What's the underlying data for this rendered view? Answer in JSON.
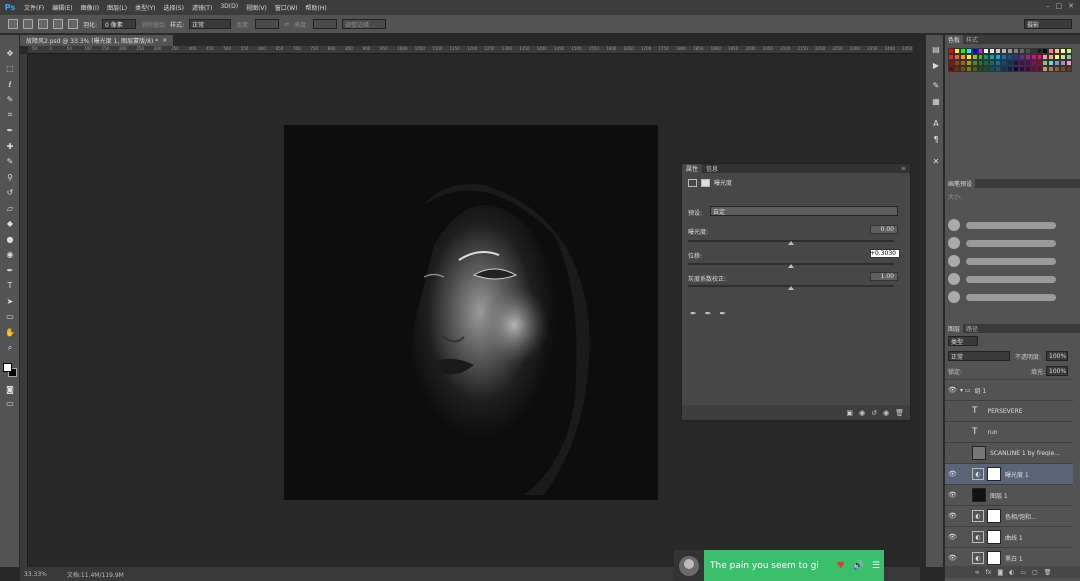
{
  "app": {
    "logo": "Ps"
  },
  "menubar": {
    "items": [
      "文件(F)",
      "编辑(E)",
      "图像(I)",
      "图层(L)",
      "类型(Y)",
      "选择(S)",
      "滤镜(T)",
      "3D(D)",
      "视图(V)",
      "窗口(W)",
      "帮助(H)"
    ],
    "window_controls": [
      "–",
      "□",
      "✕"
    ]
  },
  "options_bar": {
    "feather_label": "羽化:",
    "feather_value": "0 像素",
    "antialias_label": "消除锯齿",
    "style_label": "样式:",
    "style_value": "正常",
    "width_label": "宽度:",
    "height_label": "高度:",
    "refine_label": "调整边缘...",
    "workspace_value": "摄影"
  },
  "document": {
    "tab_title": "故障风2.psd @ 33.3% (曝光度 1, 图层蒙版/8) *",
    "tab_close": "×",
    "ruler_top_ticks": [
      "50",
      "0",
      "50",
      "100",
      "150",
      "200",
      "250",
      "300",
      "350",
      "400",
      "450",
      "500",
      "550",
      "600",
      "650",
      "700",
      "750",
      "800",
      "850",
      "900",
      "950",
      "1000",
      "1050",
      "1100",
      "1150",
      "1200",
      "1250",
      "1300",
      "1350",
      "1400",
      "1450",
      "1500",
      "1550",
      "1600",
      "1650",
      "1700",
      "1750",
      "1800",
      "1850",
      "1900",
      "1950",
      "2000",
      "2050",
      "2100",
      "2150",
      "2200",
      "2250",
      "2300",
      "2350",
      "2400",
      "2450"
    ]
  },
  "properties": {
    "tab_properties": "属性",
    "tab_info": "信息",
    "adjust_name": "曝光度",
    "preset_label": "预设:",
    "preset_value": "自定",
    "exposure_label": "曝光度:",
    "exposure_value": "0.00",
    "exposure_level": 0.5,
    "offset_label": "位移:",
    "offset_value": "+0.3030",
    "offset_level": 0.5,
    "gamma_label": "灰度系数校正:",
    "gamma_value": "1.00",
    "gamma_level": 0.5
  },
  "panels": {
    "swatches_tab": "色板",
    "styles_tab": "样式",
    "brush_presets_tab": "画笔预设",
    "brush_size_label": "大小:",
    "layers_tab": "图层",
    "paths_tab": "路径",
    "kind_label": "类型",
    "blend_mode": "正常",
    "opacity_label": "不透明度:",
    "opacity_value": "100%",
    "lock_label": "锁定:",
    "fill_label": "填充:",
    "fill_value": "100%"
  },
  "layers": [
    {
      "name": "组 1",
      "type": "group",
      "visible": true
    },
    {
      "name": "PERSEVERE",
      "type": "text",
      "visible": false
    },
    {
      "name": "run",
      "type": "text",
      "visible": false
    },
    {
      "name": "SCANLINE 1 by freqie...",
      "type": "image",
      "visible": false
    },
    {
      "name": "曝光度 1",
      "type": "adjust",
      "visible": true,
      "selected": true
    },
    {
      "name": "图层 1",
      "type": "image",
      "visible": true
    },
    {
      "name": "色相/饱和...",
      "type": "adjust",
      "visible": true
    },
    {
      "name": "曲线 1",
      "type": "adjust",
      "visible": true
    },
    {
      "name": "黑白 1",
      "type": "adjust",
      "visible": true
    }
  ],
  "status": {
    "zoom": "33.33%",
    "doc_info": "文档:11.4M/119.9M"
  },
  "music": {
    "lyric": "The pain you seem to gi"
  },
  "colors": {
    "accent_selected_layer": "#596478",
    "music_bar": "#3ac06a",
    "ps_logo": "#31a8ff"
  }
}
